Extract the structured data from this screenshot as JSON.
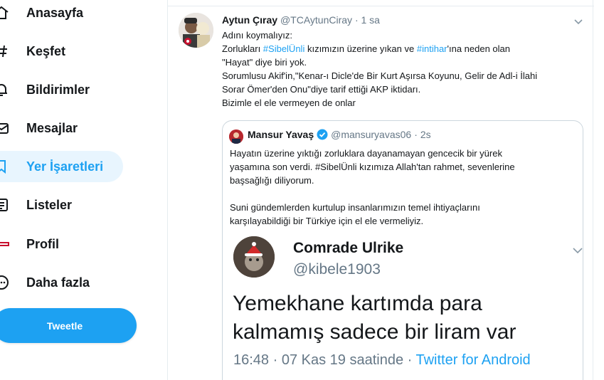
{
  "sidebar": {
    "items": [
      {
        "label": "Anasayfa",
        "icon": "home-icon"
      },
      {
        "label": "Keşfet",
        "icon": "hashtag-icon"
      },
      {
        "label": "Bildirimler",
        "icon": "bell-icon"
      },
      {
        "label": "Mesajlar",
        "icon": "envelope-icon"
      },
      {
        "label": "Yer İşaretleri",
        "icon": "bookmark-icon",
        "active": true
      },
      {
        "label": "Listeler",
        "icon": "list-icon"
      },
      {
        "label": "Profil",
        "icon": "profile-avatar-icon"
      },
      {
        "label": "Daha fazla",
        "icon": "more-circle-icon"
      }
    ],
    "tweet_button": "Tweetle"
  },
  "tweet": {
    "name": "Aytun Çıray",
    "handle": "@TCAytunCiray",
    "separator": "·",
    "time": "1 sa",
    "lines": {
      "l1": "Adını koymalıyız:",
      "l2_a": "Zorlukları ",
      "l2_tag1": "#SibelÜnli",
      "l2_b": " kızımızın üzerine yıkan ve ",
      "l2_tag2": "#intihar",
      "l2_c": "'ına neden olan",
      "l3": "\"Hayat\" diye biri yok.",
      "l4": "Sorumlusu Akif'in,\"Kenar-ı Dicle'de Bir Kurt Aşırsa Koyunu, Gelir de Adl-i İlahi",
      "l5": "Sorar Ömer'den Onu\"diye tarif ettiği AKP iktidarı.",
      "l6": "Bizimle el ele vermeyen de onlar"
    }
  },
  "quote": {
    "name": "Mansur Yavaş",
    "handle": "@mansuryavas06",
    "separator": "·",
    "time": "2s",
    "lines": {
      "l1": "Hayatın üzerine yıktığı zorluklara dayanamayan gencecik bir yürek",
      "l2": "yaşamına son verdi. #SibelÜnli kızımıza Allah'tan rahmet, sevenlerine",
      "l3": "başsağlığı diliyorum.",
      "l4": "Suni gündemlerden kurtulup insanlarımızın temel ihtiyaçlarını",
      "l5": "karşılayabildiği bir Türkiye için el ele vermeliyiz."
    },
    "image": {
      "name": "Comrade Ulrike",
      "handle": "@kibele1903",
      "text_l1": "Yemekhane kartımda para",
      "text_l2": "kalmamış sadece bir liram var",
      "footer_time": "16:48 · 07 Kas 19 saatinde · ",
      "footer_source": "Twitter for Android"
    }
  },
  "colors": {
    "accent": "#1da1f2",
    "text": "#14171a",
    "muted": "#657786",
    "border": "#e6ecf0",
    "active_bg": "#e8f5fe"
  }
}
